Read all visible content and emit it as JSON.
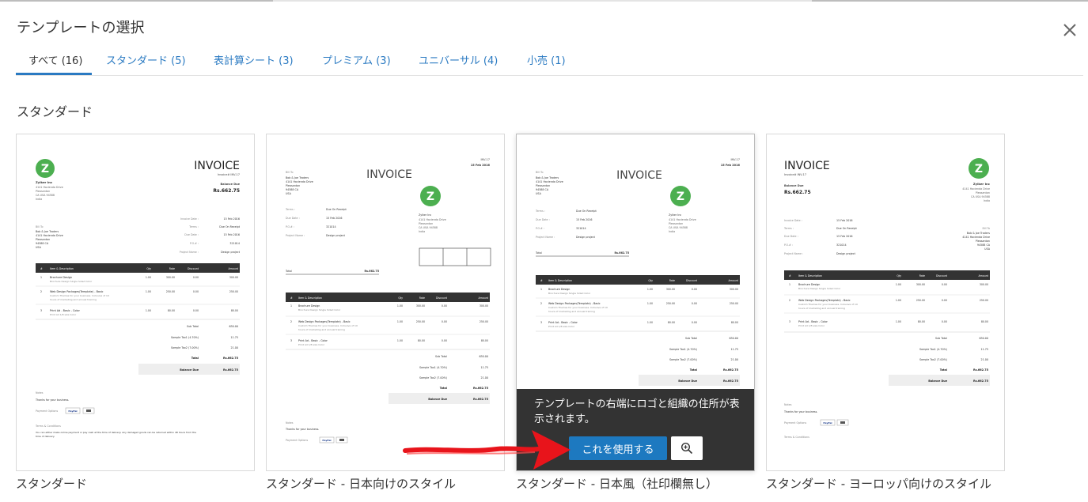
{
  "dialog": {
    "title": "テンプレートの選択"
  },
  "tabs": [
    {
      "label": "すべて (16)",
      "active": true
    },
    {
      "label": "スタンダード (5)"
    },
    {
      "label": "表計算シート (3)"
    },
    {
      "label": "プレミアム (3)"
    },
    {
      "label": "ユニバーサル (4)"
    },
    {
      "label": "小売 (1)"
    }
  ],
  "section": {
    "title": "スタンダード"
  },
  "templates": [
    {
      "label": "スタンダード"
    },
    {
      "label": "スタンダード - 日本向けのスタイル"
    },
    {
      "label": "スタンダード - 日本風（社印欄無し）",
      "overlay_description": "テンプレートの右端にロゴと組織の住所が表示されます。",
      "use_button": "これを使用する"
    },
    {
      "label": "スタンダード - ヨーロッパ向けのスタイル"
    }
  ],
  "invoice": {
    "title": "INVOICE",
    "number": "Invoice# INV-17",
    "inv_no": "INV-17",
    "logo_letter": "Z",
    "company": {
      "name": "Zylker Inc",
      "address_line1": "4141 Hacienda Drive",
      "address_line2": "Pleasanton",
      "address_line3": "CA USA 94588",
      "address_line4": "India",
      "zip_line": "94588 CA",
      "country_short": "CA USA 94588"
    },
    "balance_label": "Balance Due",
    "balance_amount": "Rs.662.75",
    "bill_to_label": "Bill To",
    "bill_to": [
      "Bob & Joe Traders",
      "4141 Hacienda Drive",
      "Pleasanton",
      "94588 CA",
      "USA"
    ],
    "meta": [
      {
        "label": "Invoice Date :",
        "value": "15 Feb 2016"
      },
      {
        "label": "Terms :",
        "value": "Due On Receipt"
      },
      {
        "label": "Due Date :",
        "value": "15 Feb 2016"
      },
      {
        "label": "P.O.# :",
        "value": "321014"
      },
      {
        "label": "Project Name :",
        "value": "Design project"
      }
    ],
    "columns": [
      "#",
      "Item & Description",
      "Qty",
      "Rate",
      "Discount",
      "Amount"
    ],
    "items": [
      {
        "no": "1",
        "name": "Brochure Design",
        "desc1": "Brochure Design Single Sided Color",
        "desc2": "",
        "qty": "1.00",
        "rate": "300.00",
        "disc": "0.00",
        "amount": "300.00"
      },
      {
        "no": "2",
        "name": "Web Design Packages(Template) - Basic",
        "desc1": "Custom Themes for your business. Inclusive of 10",
        "desc2": "hours of marketing and annual training",
        "qty": "1.00",
        "rate": "250.00",
        "disc": "0.00",
        "amount": "250.00"
      },
      {
        "no": "3",
        "name": "Print Ad - Basic - Color",
        "desc1": "Print Ad 1/8 size Color",
        "desc2": "",
        "qty": "1.00",
        "rate": "80.00",
        "disc": "0.00",
        "amount": "80.00"
      }
    ],
    "totals": [
      {
        "label": "Sub Total",
        "value": "630.00"
      },
      {
        "label": "Sample Tax1 (4.70%)",
        "value": "11.75"
      },
      {
        "label": "Sample Tax2 (7.00%)",
        "value": "21.00"
      },
      {
        "label": "Total",
        "value": "Rs.662.75"
      }
    ],
    "total_label": "Total",
    "notes_label": "Notes",
    "notes_text": "Thanks for your business.",
    "payment_label": "Payment Options",
    "paypal": "PayPal",
    "terms_label": "Terms & Conditions",
    "terms_text1": "You can either make online payment or pay cash at the time of delivery. Any damaged goods can be returned within 48 hours from the",
    "terms_text2": "time of delivery.",
    "date_short": "15 Feb 2016"
  },
  "colors": {
    "accent": "#2a7ac2",
    "logo_green": "#4caf50",
    "table_header": "#333333",
    "overlay_bg": "#333333",
    "use_button": "#1d79c0",
    "annotation_arrow": "#e8141b"
  },
  "icons": {
    "close": "close-icon",
    "zoom": "zoom-in-icon",
    "arrow": "red-arrow-annotation"
  }
}
